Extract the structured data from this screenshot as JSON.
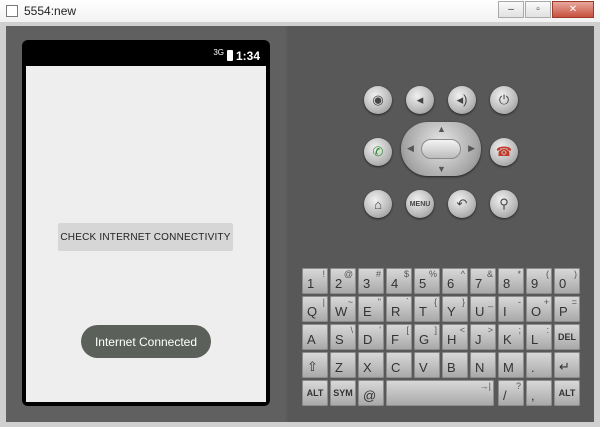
{
  "window": {
    "title": "5554:new",
    "minimize": "‒",
    "maximize": "▫",
    "close": "✕"
  },
  "phone": {
    "status": {
      "network": "3G",
      "time": "1:34"
    },
    "app": {
      "check_button": "CHECK INTERNET CONNECTIVITY",
      "toast": "Internet Connected"
    }
  },
  "controls": {
    "camera": "camera-icon",
    "volume_down": "volume-down-icon",
    "volume_up": "volume-up-icon",
    "power": "power-icon",
    "call": "call-icon",
    "end_call": "end-call-icon",
    "home": "home-icon",
    "menu_label": "MENU",
    "back": "back-icon",
    "search": "search-icon"
  },
  "keyboard": {
    "row1": [
      {
        "main": "1",
        "sub": "!"
      },
      {
        "main": "2",
        "sub": "@"
      },
      {
        "main": "3",
        "sub": "#"
      },
      {
        "main": "4",
        "sub": "$"
      },
      {
        "main": "5",
        "sub": "%"
      },
      {
        "main": "6",
        "sub": "^"
      },
      {
        "main": "7",
        "sub": "&"
      },
      {
        "main": "8",
        "sub": "*"
      },
      {
        "main": "9",
        "sub": "("
      },
      {
        "main": "0",
        "sub": ")"
      }
    ],
    "row2": [
      {
        "main": "Q",
        "sub": "|"
      },
      {
        "main": "W",
        "sub": "~"
      },
      {
        "main": "E",
        "sub": "\""
      },
      {
        "main": "R",
        "sub": "`"
      },
      {
        "main": "T",
        "sub": "{"
      },
      {
        "main": "Y",
        "sub": "}"
      },
      {
        "main": "U",
        "sub": "_"
      },
      {
        "main": "I",
        "sub": "-"
      },
      {
        "main": "O",
        "sub": "+"
      },
      {
        "main": "P",
        "sub": "="
      }
    ],
    "row3": [
      {
        "main": "A",
        "sub": ""
      },
      {
        "main": "S",
        "sub": "\\"
      },
      {
        "main": "D",
        "sub": "'"
      },
      {
        "main": "F",
        "sub": "["
      },
      {
        "main": "G",
        "sub": "]"
      },
      {
        "main": "H",
        "sub": "<"
      },
      {
        "main": "J",
        "sub": ">"
      },
      {
        "main": "K",
        "sub": ";"
      },
      {
        "main": "L",
        "sub": ":"
      },
      {
        "main": "DEL",
        "sub": ""
      }
    ],
    "row4": [
      {
        "main": "⇧",
        "sub": ""
      },
      {
        "main": "Z",
        "sub": ""
      },
      {
        "main": "X",
        "sub": ""
      },
      {
        "main": "C",
        "sub": ""
      },
      {
        "main": "V",
        "sub": ""
      },
      {
        "main": "B",
        "sub": ""
      },
      {
        "main": "N",
        "sub": ""
      },
      {
        "main": "M",
        "sub": ""
      },
      {
        "main": ".",
        "sub": ""
      },
      {
        "main": "↵",
        "sub": ""
      }
    ],
    "row5": {
      "alt_left": "ALT",
      "sym": "SYM",
      "at": "@",
      "space_sub": "→|",
      "slash": "/",
      "slash_sub": "?",
      "comma": ",",
      "alt_right": "ALT"
    }
  }
}
